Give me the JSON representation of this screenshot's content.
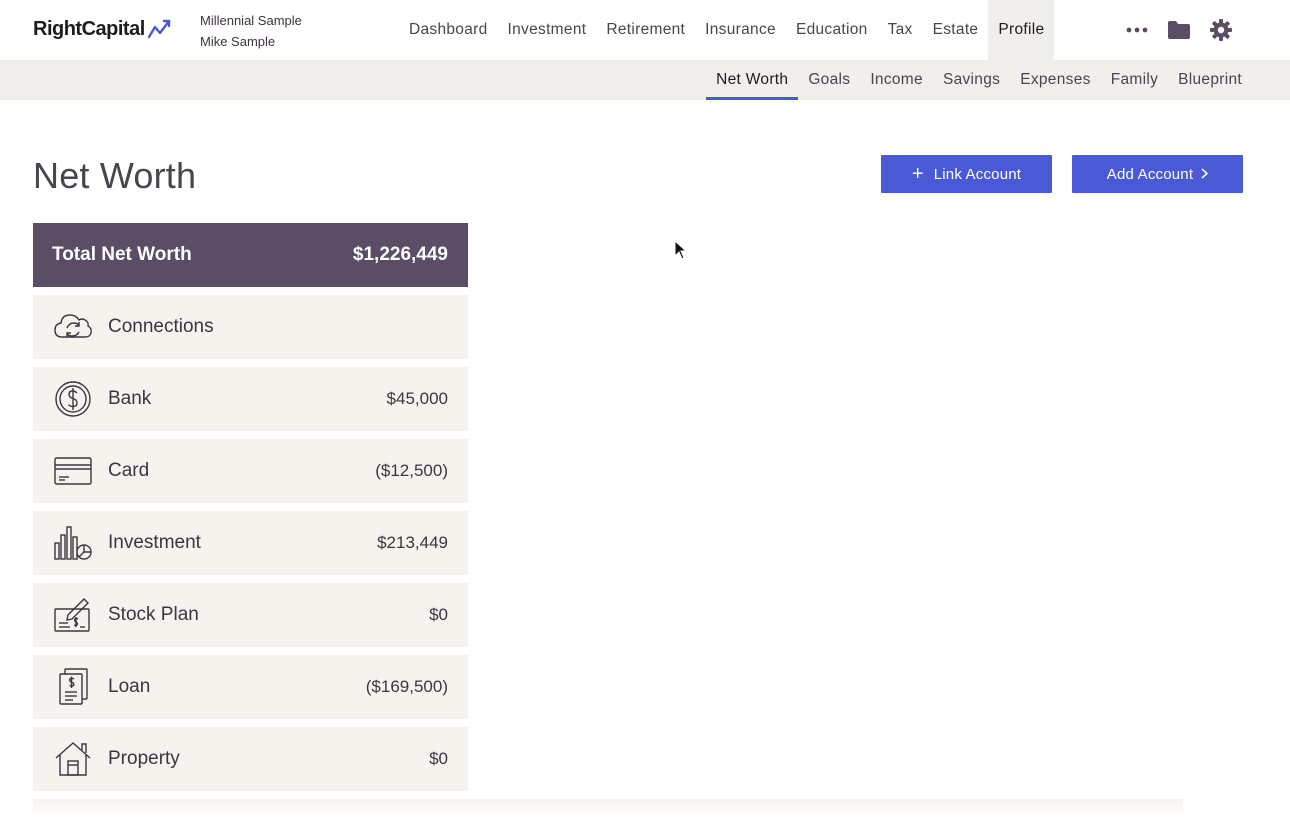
{
  "brand": {
    "name": "RightCapital",
    "accent": "#4a5ad6"
  },
  "client": {
    "plan": "Millennial Sample",
    "name": "Mike Sample"
  },
  "main_nav": [
    {
      "label": "Dashboard"
    },
    {
      "label": "Investment"
    },
    {
      "label": "Retirement"
    },
    {
      "label": "Insurance"
    },
    {
      "label": "Education"
    },
    {
      "label": "Tax"
    },
    {
      "label": "Estate"
    },
    {
      "label": "Profile",
      "active": true
    }
  ],
  "top_icons": [
    "more-icon",
    "folder-icon",
    "gear-icon"
  ],
  "sub_nav": [
    {
      "label": "Net Worth",
      "active": true
    },
    {
      "label": "Goals"
    },
    {
      "label": "Income"
    },
    {
      "label": "Savings"
    },
    {
      "label": "Expenses"
    },
    {
      "label": "Family"
    },
    {
      "label": "Blueprint"
    }
  ],
  "page": {
    "title": "Net Worth",
    "link_account_label": "Link Account",
    "add_account_label": "Add Account"
  },
  "summary": {
    "total_label": "Total Net Worth",
    "total_value": "$1,226,449",
    "header_color": "#5a4d65"
  },
  "categories": [
    {
      "label": "Connections",
      "value": "",
      "icon": "cloud-sync-icon"
    },
    {
      "label": "Bank",
      "value": "$45,000",
      "icon": "dollar-coin-icon"
    },
    {
      "label": "Card",
      "value": "($12,500)",
      "icon": "credit-card-icon"
    },
    {
      "label": "Investment",
      "value": "$213,449",
      "icon": "bar-pie-chart-icon"
    },
    {
      "label": "Stock Plan",
      "value": "$0",
      "icon": "signed-check-icon"
    },
    {
      "label": "Loan",
      "value": "($169,500)",
      "icon": "loan-document-icon"
    },
    {
      "label": "Property",
      "value": "$0",
      "icon": "house-icon"
    }
  ]
}
